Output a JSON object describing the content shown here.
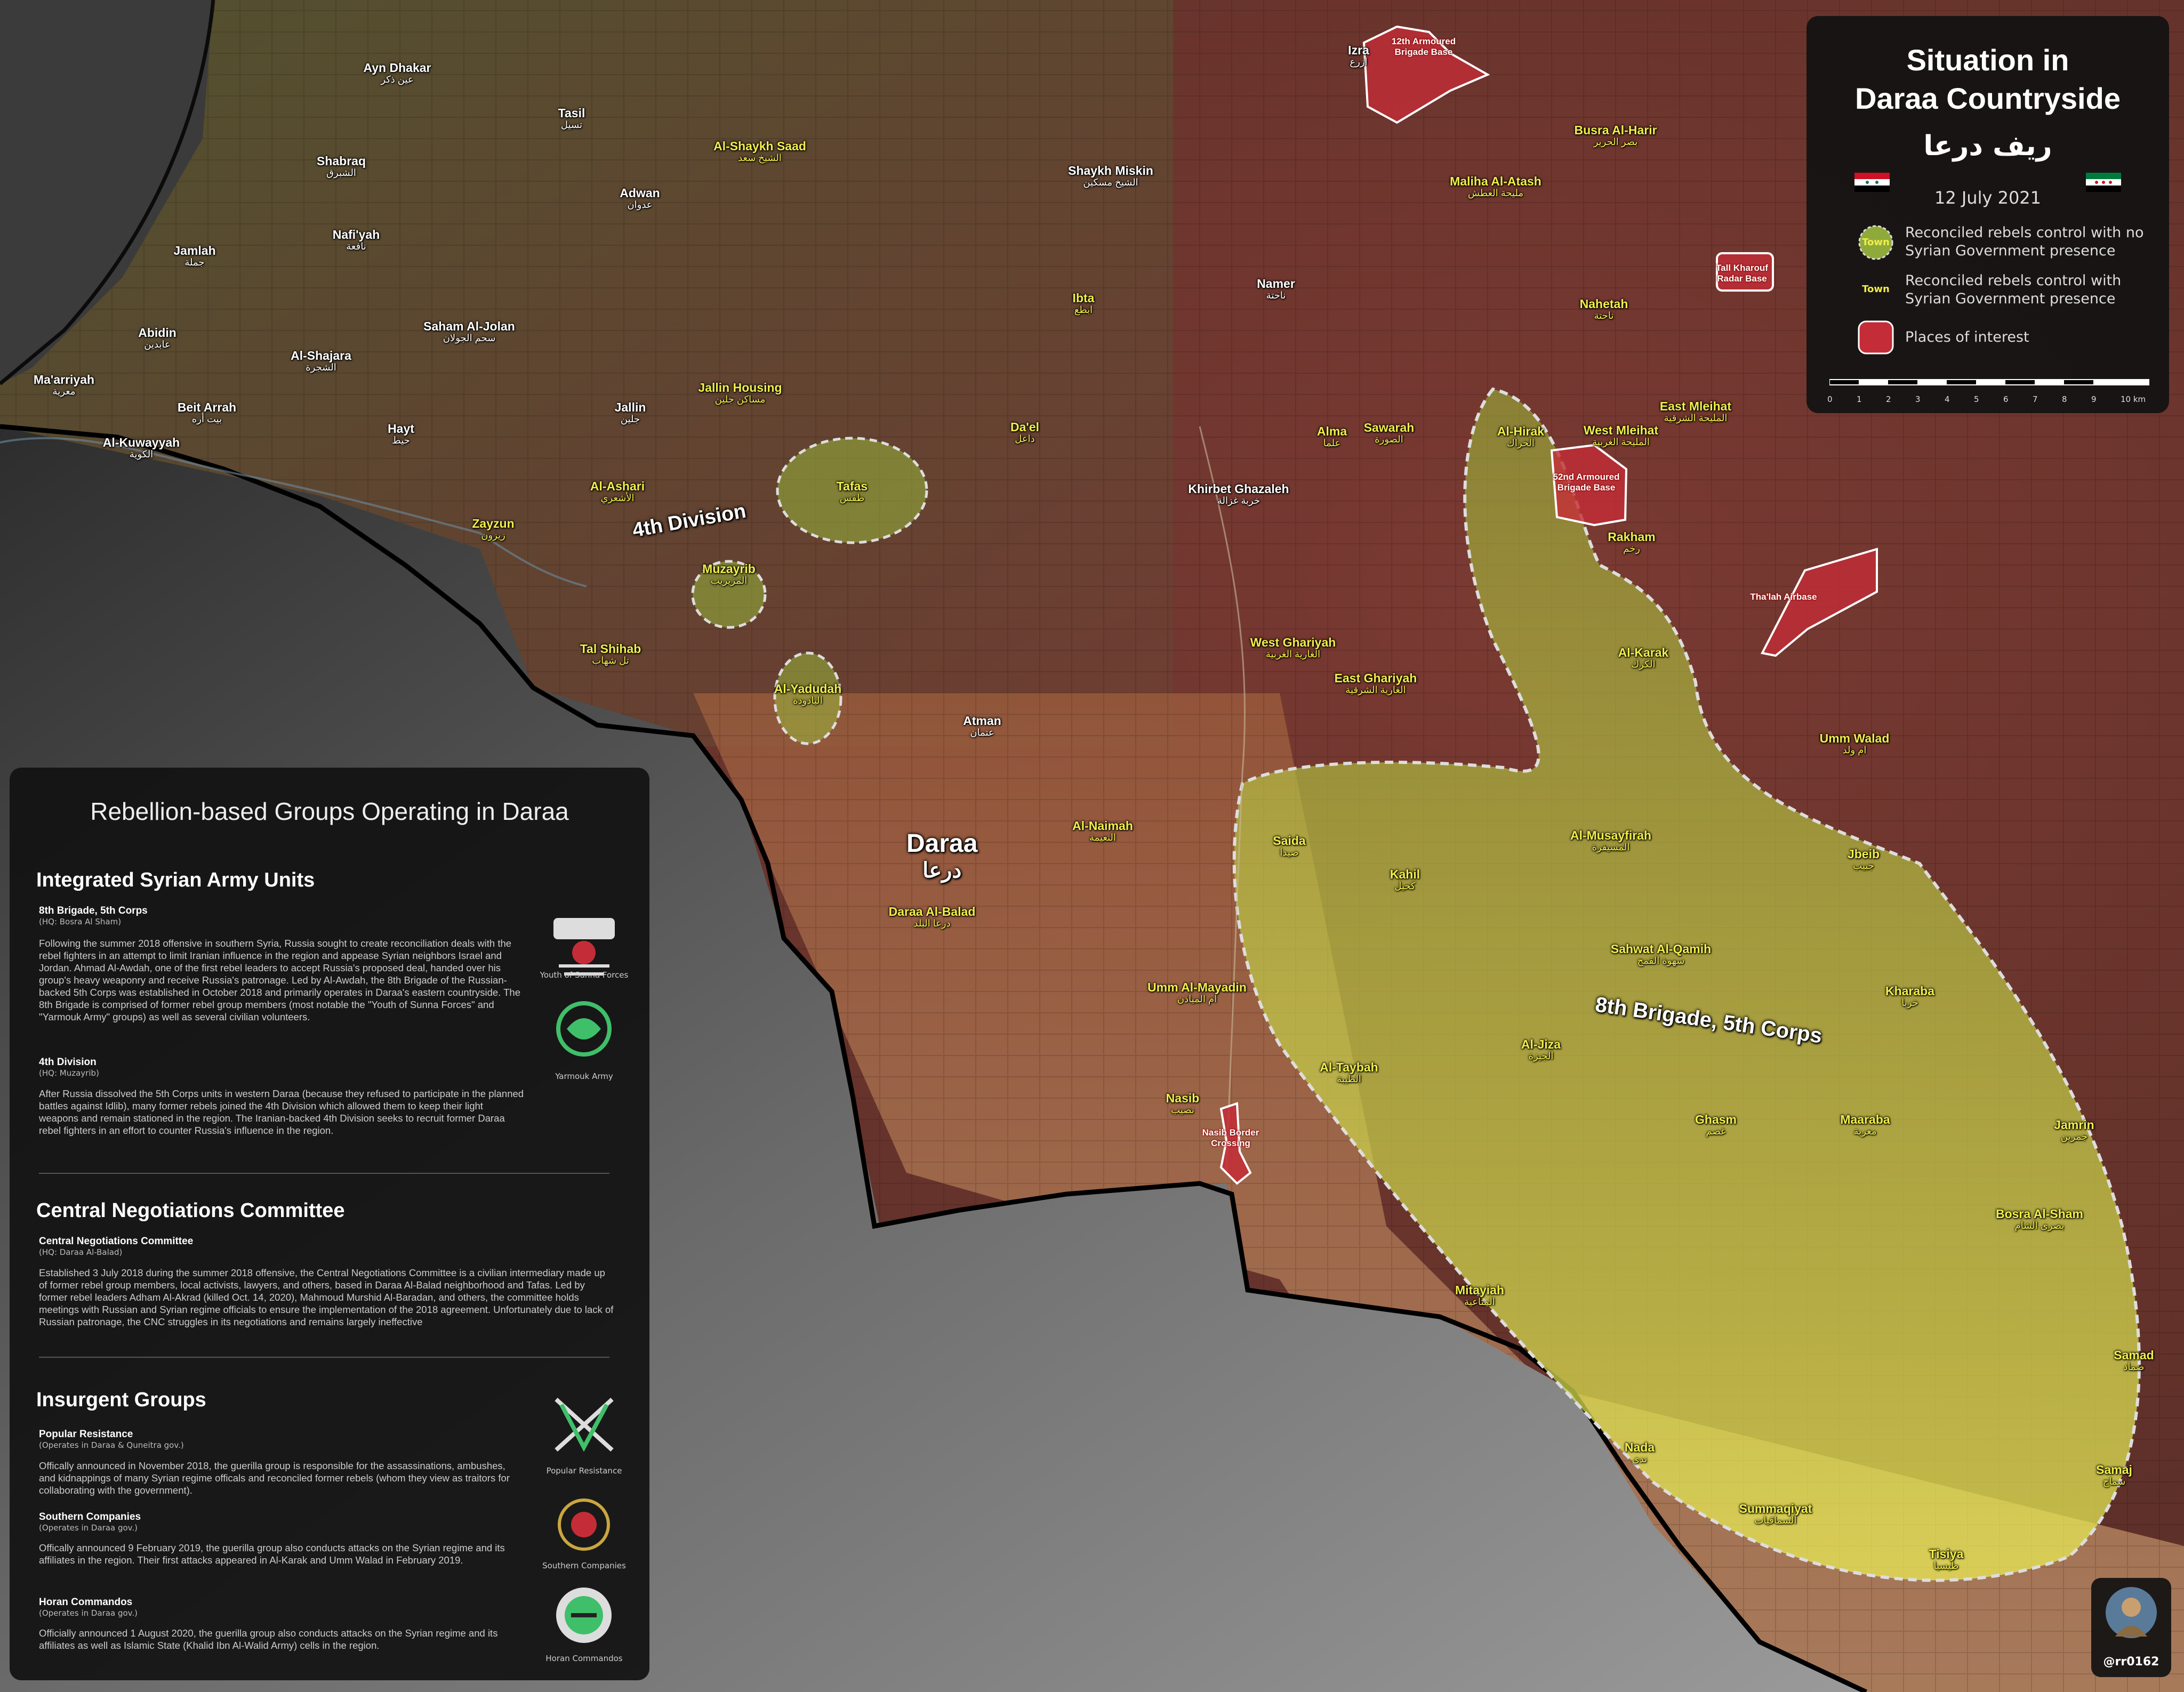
{
  "title": {
    "line1": "Situation in",
    "line2": "Daraa Countryside",
    "arabic": "ريف درعا"
  },
  "date": "12 July 2021",
  "colors": {
    "reconciled_no_gov": "#a7c33a",
    "reconciled_gov": "#f1ee4b",
    "places_of_interest": "#c42d37",
    "border": "#000000"
  },
  "legend": {
    "items": [
      {
        "swatch_label": "Town",
        "text_1": "Reconciled rebels control with no",
        "text_2": "Syrian Government presence"
      },
      {
        "swatch_label": "Town",
        "text_1": "Reconciled rebels control with",
        "text_2": "Syrian Government presence"
      },
      {
        "swatch_label": "",
        "text_1": "Places of interest",
        "text_2": ""
      }
    ],
    "scale": {
      "ticks": [
        "0",
        "1",
        "2",
        "3",
        "4",
        "5",
        "6",
        "7",
        "8",
        "9",
        "10 km"
      ]
    }
  },
  "groups_panel": {
    "heading": "Rebellion-based Groups Operating in Daraa",
    "sec1": {
      "title": "Integrated Syrian Army Units",
      "u1_name": "8th Brigade, 5th Corps",
      "u1_hq": "(HQ: Bosra Al Sham)",
      "u1_text": "Following the summer 2018 offensive in southern Syria, Russia sought to create reconciliation deals with the rebel fighters in an attempt to limit Iranian influence in the region and appease Syrian neighbors Israel and Jordan. Ahmad Al-Awdah, one of the first rebel leaders to accept Russia's proposed deal, handed over his group's heavy weaponry and receive Russia's patronage. Led by Al-Awdah, the 8th Brigade of the Russian-backed 5th Corps was established in October 2018 and primarily operates in Daraa's eastern countryside. The 8th Brigade is comprised of former rebel group members (most notable the \"Youth of Sunna Forces\" and \"Yarmouk Army\" groups) as well as several civilian volunteers.",
      "u2_name": "4th Division",
      "u2_hq": "(HQ: Muzayrib)",
      "u2_text": "After Russia dissolved the 5th Corps units in western Daraa (because they refused to participate in the planned battles against Idlib), many former rebels joined the 4th Division which allowed them to keep their light weapons and remain stationed in the region. The Iranian-backed 4th Division seeks to recruit former Daraa rebel fighters in an effort to counter Russia's influence in the region.",
      "logo1_caption": "Youth of Sunna Forces",
      "logo2_caption": "Yarmouk Army"
    },
    "sec2": {
      "title": "Central Negotiations Committee",
      "u_name": "Central Negotiations Committee",
      "u_hq": "(HQ: Daraa Al-Balad)",
      "u_text": "Established 3 July 2018 during the summer 2018 offensive, the Central Negotiations Committee is a civilian intermediary made up of former rebel group members, local activists, lawyers, and others, based in Daraa Al-Balad neighborhood and Tafas. Led by former rebel leaders Adham Al-Akrad (killed Oct. 14, 2020), Mahmoud Murshid Al-Baradan, and others, the committee holds meetings with Russian and Syrian regime officials to ensure the implementation of the 2018 agreement. Unfortunately due to lack of Russian patronage, the CNC struggles in its negotiations and remains largely ineffective"
    },
    "sec3": {
      "title": "Insurgent Groups",
      "g1_name": "Popular Resistance",
      "g1_hq": "(Operates in Daraa & Quneitra gov.)",
      "g1_text": "Offically announced in November 2018, the guerilla group is responsible for the assassinations, ambushes, and kidnappings of many Syrian regime officals and reconciled former rebels (whom they view as traitors for collaborating with the government).",
      "g2_name": "Southern Companies",
      "g2_hq": "(Operates in Daraa gov.)",
      "g2_text": "Offically announced 9 February 2019, the guerilla group also conducts attacks on the Syrian regime and its affiliates in the region. Their first attacks appeared in Al-Karak and Umm Walad in February 2019.",
      "g3_name": "Horan Commandos",
      "g3_hq": "(Operates in Daraa gov.)",
      "g3_text": "Officially announced 1 August 2020, the guerilla group also conducts attacks on the Syrian regime and its affiliates as well as Islamic State (Khalid Ibn Al-Walid Army) cells in the region.",
      "logo1_caption": "Popular Resistance",
      "logo2_caption": "Southern Companies",
      "logo3_caption": "Horan Commandos"
    }
  },
  "credit": "@rr0162",
  "map_labels": {
    "daraa": {
      "en": "Daraa",
      "ar": "درعا"
    },
    "division4": "4th Division",
    "brigade8": "8th Brigade, 5th Corps",
    "pois": [
      {
        "l1": "12th Armoured",
        "l2": "Brigade Base"
      },
      {
        "l1": "Tall Kharouf",
        "l2": "Radar Base"
      },
      {
        "l1": "52nd Armoured",
        "l2": "Brigade Base"
      },
      {
        "l1": "Tha'lah Airbase",
        "l2": ""
      },
      {
        "l1": "Nasib Border",
        "l2": "Crossing"
      }
    ],
    "towns": [
      {
        "en": "Ayn Dhakar",
        "ar": "عين ذكر",
        "c": "w"
      },
      {
        "en": "Shabraq",
        "ar": "الشبرق",
        "c": "w"
      },
      {
        "en": "Tasil",
        "ar": "تسيل",
        "c": "w"
      },
      {
        "en": "Jamlah",
        "ar": "جملة",
        "c": "w"
      },
      {
        "en": "Nafi'yah",
        "ar": "نافعة",
        "c": "w"
      },
      {
        "en": "Adwan",
        "ar": "عدوان",
        "c": "w"
      },
      {
        "en": "Abidin",
        "ar": "عابدين",
        "c": "w"
      },
      {
        "en": "Saham Al-Jolan",
        "ar": "سحم الجولان",
        "c": "w"
      },
      {
        "en": "Al-Shajara",
        "ar": "الشجرة",
        "c": "w"
      },
      {
        "en": "Ma'arriyah",
        "ar": "معرية",
        "c": "w"
      },
      {
        "en": "Beit Arrah",
        "ar": "بيت أره",
        "c": "w"
      },
      {
        "en": "Al-Kuwayyah",
        "ar": "الكوية",
        "c": "w"
      },
      {
        "en": "Hayt",
        "ar": "حيط",
        "c": "w"
      },
      {
        "en": "Jallin",
        "ar": "جلين",
        "c": "w"
      },
      {
        "en": "Al-Shaykh Saad",
        "ar": "الشيخ سعد",
        "c": "y"
      },
      {
        "en": "Jallin Housing",
        "ar": "مساكن جلين",
        "c": "y"
      },
      {
        "en": "Al-Ashari",
        "ar": "الأشعري",
        "c": "y"
      },
      {
        "en": "Zayzun",
        "ar": "زيزون",
        "c": "y"
      },
      {
        "en": "Tal Shihab",
        "ar": "تل شهاب",
        "c": "y"
      },
      {
        "en": "Tafas",
        "ar": "طفس",
        "c": "y"
      },
      {
        "en": "Muzayrib",
        "ar": "المزيريب",
        "c": "y"
      },
      {
        "en": "Al-Yadudah",
        "ar": "اليادودة",
        "c": "y"
      },
      {
        "en": "Izra",
        "ar": "ازرع",
        "c": "w"
      },
      {
        "en": "Shaykh Miskin",
        "ar": "الشيخ مسكين",
        "c": "w"
      },
      {
        "en": "Ibta",
        "ar": "ابطع",
        "c": "y"
      },
      {
        "en": "Da'el",
        "ar": "داعل",
        "c": "y"
      },
      {
        "en": "Namer",
        "ar": "ناحتة",
        "c": "w"
      },
      {
        "en": "Khirbet Ghazaleh",
        "ar": "خربة غزالة",
        "c": "w"
      },
      {
        "en": "Alma",
        "ar": "علما",
        "c": "y"
      },
      {
        "en": "Sawarah",
        "ar": "الصورة",
        "c": "y"
      },
      {
        "en": "West Ghariyah",
        "ar": "الغارية الغربية",
        "c": "y"
      },
      {
        "en": "East Ghariyah",
        "ar": "الغارية الشرقية",
        "c": "y"
      },
      {
        "en": "Atman",
        "ar": "عتمان",
        "c": "w"
      },
      {
        "en": "Daraa Al-Balad",
        "ar": "درعا البلد",
        "c": "y"
      },
      {
        "en": "Al-Naimah",
        "ar": "النعيمة",
        "c": "y"
      },
      {
        "en": "Umm Al-Mayadin",
        "ar": "ام المياذن",
        "c": "y"
      },
      {
        "en": "Nasib",
        "ar": "نصيب",
        "c": "y"
      },
      {
        "en": "Busra Al-Harir",
        "ar": "بصر الحرير",
        "c": "y"
      },
      {
        "en": "Maliha Al-Atash",
        "ar": "مليحة العطش",
        "c": "y"
      },
      {
        "en": "Nahetah",
        "ar": "ناحتة",
        "c": "y"
      },
      {
        "en": "East Mleihat",
        "ar": "المليحة الشرقية",
        "c": "y"
      },
      {
        "en": "West Mleihat",
        "ar": "المليحة الغربية",
        "c": "y"
      },
      {
        "en": "Al-Hirak",
        "ar": "الحراك",
        "c": "y"
      },
      {
        "en": "Rakham",
        "ar": "رخم",
        "c": "y"
      },
      {
        "en": "Al-Karak",
        "ar": "الكرك",
        "c": "y"
      },
      {
        "en": "Umm Walad",
        "ar": "ام ولد",
        "c": "y"
      },
      {
        "en": "Saida",
        "ar": "صيدا",
        "c": "y"
      },
      {
        "en": "Kahil",
        "ar": "كحيل",
        "c": "y"
      },
      {
        "en": "Al-Musayfirah",
        "ar": "المسيفرة",
        "c": "y"
      },
      {
        "en": "Jbeib",
        "ar": "جبيب",
        "c": "y"
      },
      {
        "en": "Sahwat Al-Qamih",
        "ar": "سهوة القمح",
        "c": "y"
      },
      {
        "en": "Kharaba",
        "ar": "خربا",
        "c": "y"
      },
      {
        "en": "Al-Jiza",
        "ar": "الجيزة",
        "c": "y"
      },
      {
        "en": "Al-Taybah",
        "ar": "الطيبة",
        "c": "y"
      },
      {
        "en": "Ghasm",
        "ar": "غصم",
        "c": "y"
      },
      {
        "en": "Maaraba",
        "ar": "معربة",
        "c": "y"
      },
      {
        "en": "Jamrin",
        "ar": "جمرين",
        "c": "y"
      },
      {
        "en": "Bosra Al-Sham",
        "ar": "بصرى الشام",
        "c": "y"
      },
      {
        "en": "Mitayiah",
        "ar": "المتاعية",
        "c": "y"
      },
      {
        "en": "Samad",
        "ar": "صماد",
        "c": "y"
      },
      {
        "en": "Nada",
        "ar": "ندى",
        "c": "y"
      },
      {
        "en": "Samaj",
        "ar": "سماج",
        "c": "y"
      },
      {
        "en": "Summaqiyat",
        "ar": "السماقيات",
        "c": "y"
      },
      {
        "en": "Tisiya",
        "ar": "طيسيا",
        "c": "y"
      }
    ]
  }
}
